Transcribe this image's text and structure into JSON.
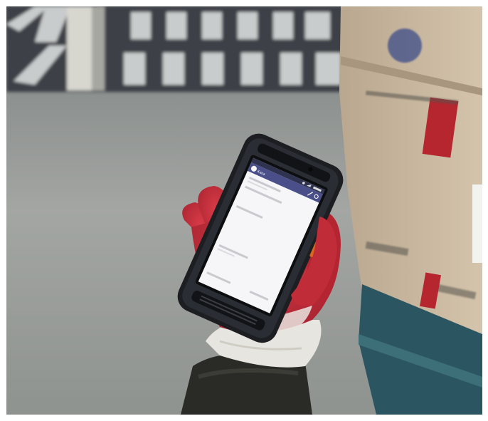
{
  "image": {
    "kind": "photograph",
    "device": {
      "status_bar": {
        "icons": [
          "signal-icon",
          "wifi-icon",
          "battery-icon"
        ]
      },
      "app_bar": {
        "title": "Kaza",
        "icons": [
          "app-logo-icon",
          "edit-icon",
          "clock-icon"
        ]
      }
    },
    "colors": {
      "floor": "#9a9d9b",
      "box": "#c9b7a0",
      "glove": "#c9303c",
      "phone": "#1c1e22",
      "screen": "#f6f6f8",
      "app_bar": "#4a4f8a"
    }
  }
}
